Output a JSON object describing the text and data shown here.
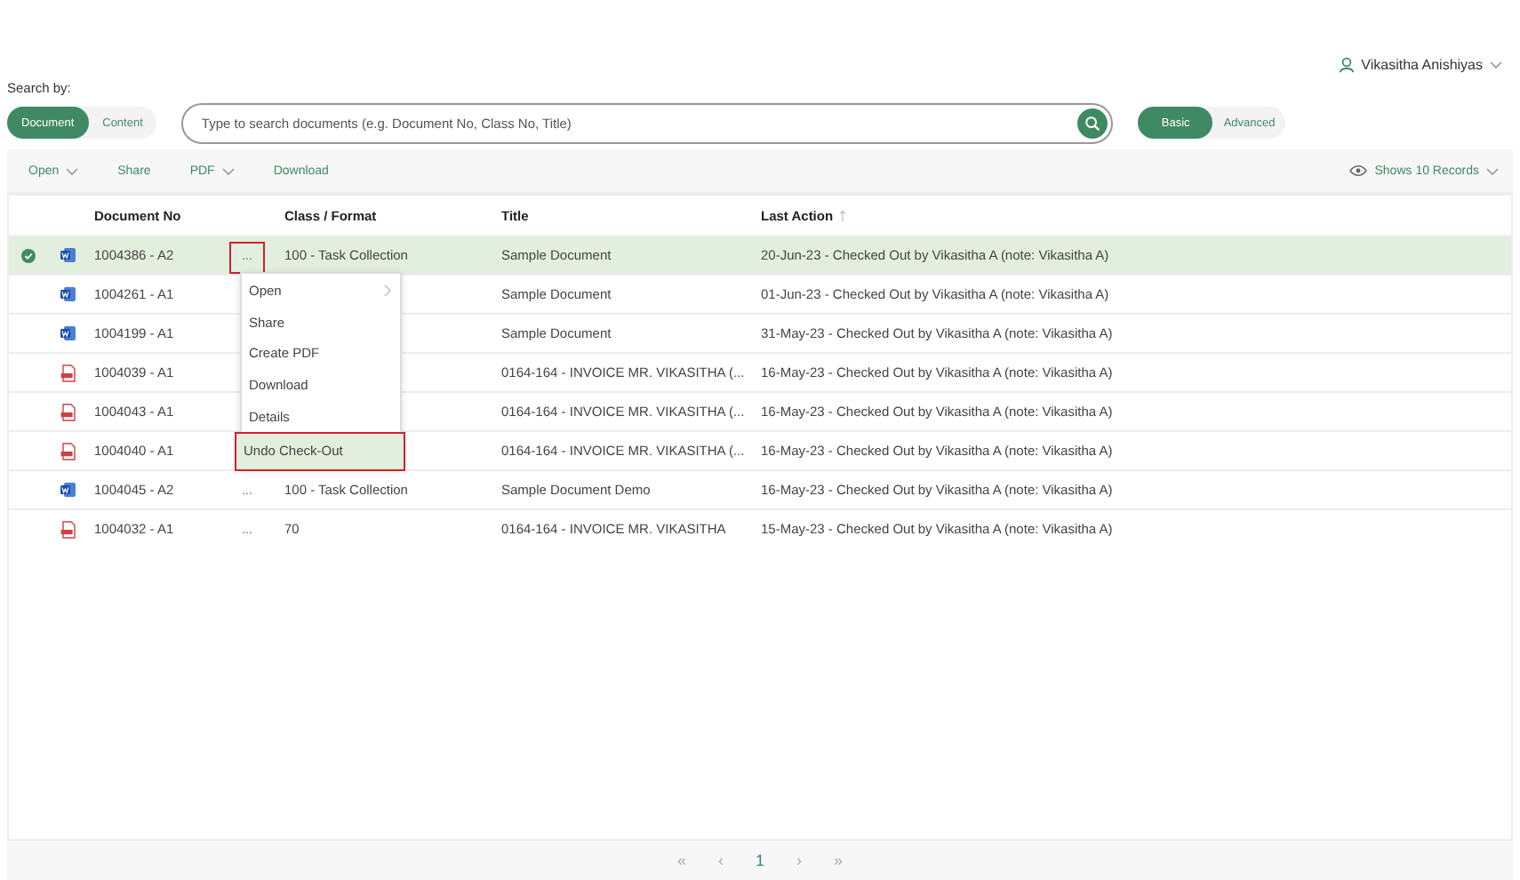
{
  "user": {
    "name": "Vikasitha Anishiyas"
  },
  "search": {
    "label": "Search by:",
    "modes": [
      {
        "label": "Document",
        "selected": true
      },
      {
        "label": "Content",
        "selected": false
      }
    ],
    "placeholder": "Type to search documents (e.g. Document No, Class No, Title)",
    "types": [
      {
        "label": "Basic",
        "selected": true
      },
      {
        "label": "Advanced",
        "selected": false
      }
    ]
  },
  "toolbar": {
    "actions": [
      {
        "label": "Open",
        "dropdown": true
      },
      {
        "label": "Share",
        "dropdown": false
      },
      {
        "label": "PDF",
        "dropdown": true
      },
      {
        "label": "Download",
        "dropdown": false
      }
    ],
    "records": "Shows 10 Records"
  },
  "table": {
    "columns": [
      {
        "label": "Document No",
        "sorted": false
      },
      {
        "label": "Class / Format",
        "sorted": false
      },
      {
        "label": "Title",
        "sorted": false
      },
      {
        "label": "Last Action",
        "sorted": true
      }
    ],
    "rows": [
      {
        "selected": true,
        "kind": "word",
        "doc_no": "1004386 - A2",
        "menu": "...",
        "menu_annotated": true,
        "class": "100 - Task Collection",
        "title": "Sample Document",
        "last_action": "20-Jun-23 - Checked Out by Vikasitha A (note: Vikasitha A)"
      },
      {
        "selected": false,
        "kind": "word",
        "doc_no": "1004261 - A1",
        "title": "Sample Document",
        "last_action": "01-Jun-23 - Checked Out by Vikasitha A (note: Vikasitha A)"
      },
      {
        "selected": false,
        "kind": "word",
        "doc_no": "1004199 - A1",
        "title": "Sample Document",
        "last_action": "31-May-23 - Checked Out by Vikasitha A (note: Vikasitha A)"
      },
      {
        "selected": false,
        "kind": "pdf",
        "doc_no": "1004039 - A1",
        "title": "0164-164 - INVOICE MR. VIKASITHA (...",
        "last_action": "16-May-23 - Checked Out by Vikasitha A (note: Vikasitha A)"
      },
      {
        "selected": false,
        "kind": "pdf",
        "doc_no": "1004043 - A1",
        "title": "0164-164 - INVOICE MR. VIKASITHA (...",
        "last_action": "16-May-23 - Checked Out by Vikasitha A (note: Vikasitha A)"
      },
      {
        "selected": false,
        "kind": "pdf",
        "doc_no": "1004040 - A1",
        "title": "0164-164 - INVOICE MR. VIKASITHA (...",
        "last_action": "16-May-23 - Checked Out by Vikasitha A (note: Vikasitha A)"
      },
      {
        "selected": false,
        "kind": "word",
        "doc_no": "1004045 - A2",
        "menu": "...",
        "menu_annotated": false,
        "class": "100 - Task Collection",
        "title": "Sample Document Demo",
        "last_action": "16-May-23 - Checked Out by Vikasitha A (note: Vikasitha A)"
      },
      {
        "selected": false,
        "kind": "pdf",
        "doc_no": "1004032 - A1",
        "menu": "...",
        "menu_annotated": false,
        "class": "70",
        "title": "0164-164 - INVOICE MR. VIKASITHA",
        "last_action": "15-May-23 - Checked Out by Vikasitha A (note: Vikasitha A)"
      }
    ]
  },
  "context_menu": {
    "items": [
      {
        "label": "Open",
        "submenu": true,
        "annotated": false
      },
      {
        "label": "Share",
        "submenu": false,
        "annotated": false
      },
      {
        "label": "Create PDF",
        "submenu": false,
        "annotated": false
      },
      {
        "label": "Download",
        "submenu": false,
        "annotated": false
      },
      {
        "label": "Details",
        "submenu": false,
        "annotated": false
      },
      {
        "label": "Undo Check-Out",
        "submenu": false,
        "annotated": true
      }
    ]
  },
  "pagination": [
    {
      "label": "«",
      "kind": "nav"
    },
    {
      "label": "‹",
      "kind": "nav"
    },
    {
      "label": "1",
      "kind": "page"
    },
    {
      "label": "›",
      "kind": "nav"
    },
    {
      "label": "»",
      "kind": "nav"
    }
  ]
}
